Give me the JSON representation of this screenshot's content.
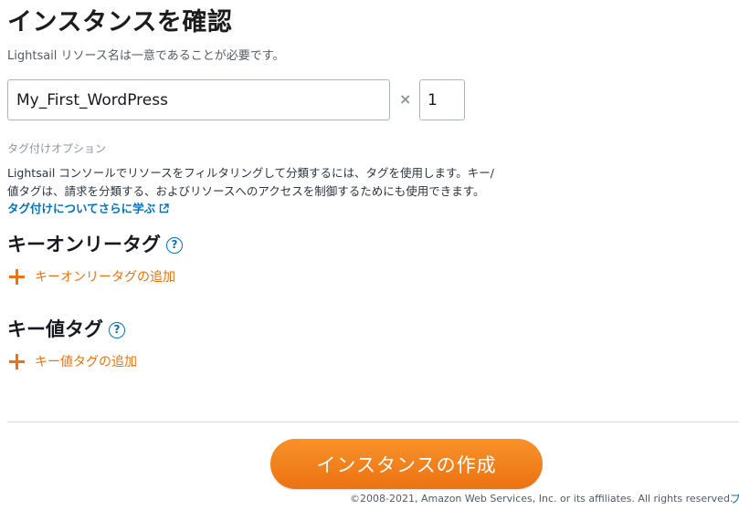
{
  "header": {
    "title": "インスタンスを確認",
    "subtitle": "Lightsail リソース名は一意であることが必要です。"
  },
  "instance": {
    "name_value": "My_First_WordPress",
    "times_symbol": "×",
    "quantity_value": "1"
  },
  "tags": {
    "option_label": "タグ付けオプション",
    "description_line1": "Lightsail コンソールでリソースをフィルタリングして分類するには、タグを使用します。キー/",
    "description_line2": "値タグは、請求を分類する、およびリソースへのアクセスを制御するためにも使用できます。",
    "learn_more_link": "タグ付けについてさらに学ぶ",
    "key_only": {
      "title": "キーオンリータグ",
      "help_symbol": "?",
      "add_label": "キーオンリータグの追加"
    },
    "key_value": {
      "title": "キー値タグ",
      "help_symbol": "?",
      "add_label": "キー値タグの追加"
    }
  },
  "actions": {
    "create_label": "インスタンスの作成"
  },
  "footer": {
    "copyright": "©2008-2021, Amazon Web Services, Inc. or its affiliates. All rights reserved.",
    "link_partial": "プ"
  },
  "colors": {
    "accent_orange": "#ec7211",
    "link_blue": "#0073bb",
    "title_text": "#16191f"
  },
  "icons": {
    "external_link": "external-link-icon",
    "help": "help-circle-icon",
    "add": "plus-icon"
  }
}
